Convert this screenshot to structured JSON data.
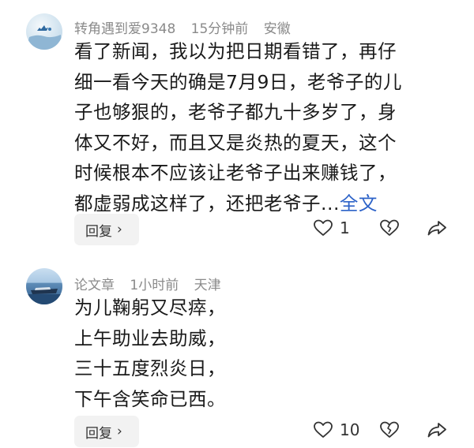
{
  "comments": [
    {
      "username": "转角遇到爱9348",
      "time": "15分钟前",
      "location": "安徽",
      "lines": [
        "看了新闻，我以为把日期看错了，再仔",
        "细一看今天的确是7月9日，老爷子的儿",
        "子也够狠的，老爷子都九十多岁了，身",
        "体又不好，而且又是炎热的夏天，这个",
        "时候根本不应该让老爷子出来赚钱了，",
        "都虚弱成这样了，还把老爷子..."
      ],
      "more_label": "全文",
      "reply_label": "回复",
      "reply_chevron": "›",
      "like_count": "1"
    },
    {
      "username": "论文章",
      "time": "1小时前",
      "location": "天津",
      "lines": [
        "为儿鞠躬又尽瘁，",
        "上午助业去助威，",
        "三十五度烈炎日，",
        "下午含笑命已西。"
      ],
      "reply_label": "回复",
      "reply_chevron": "›",
      "like_count": "10"
    }
  ],
  "icons": {
    "like": "heart-outline-icon",
    "dislike": "broken-heart-icon",
    "share": "share-arrow-icon"
  },
  "colors": {
    "link": "#2d63c8",
    "meta": "#8a8a8a",
    "reply_bg": "#f2f2f2"
  }
}
